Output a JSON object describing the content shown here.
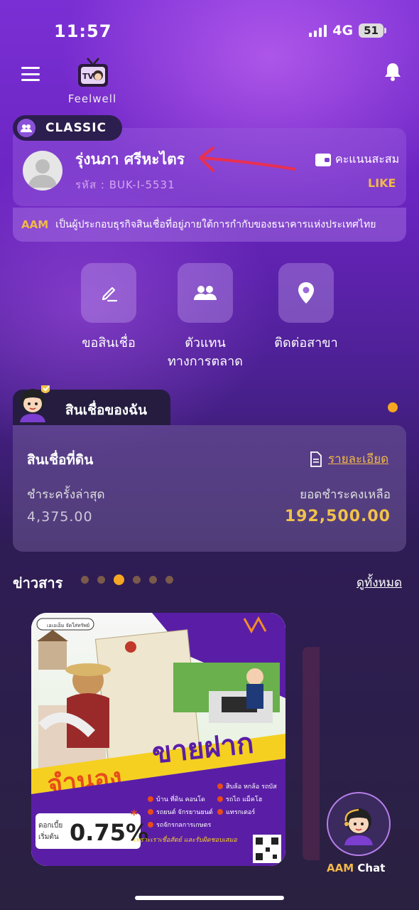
{
  "status_bar": {
    "time": "11:57",
    "network": "4G",
    "battery": "51"
  },
  "header": {
    "logo_text": "Feelwell",
    "logo_badge": "TV"
  },
  "profile": {
    "tier": "CLASSIC",
    "name": "รุ่งนภา ศรีหะไตร",
    "code": "รหัส : BUK-I-5531",
    "points_label": "คะแนนสะสม",
    "points_value": "LIKE"
  },
  "notice": {
    "brand": "AAM",
    "text": "เป็นผู้ประกอบธุรกิจสินเชื่อที่อยู่ภายใต้การกำกับของธนาคารแห่งประเทศไทย"
  },
  "actions": [
    {
      "label": "ขอสินเชื่อ",
      "icon": "pencil-icon"
    },
    {
      "label": "ตัวแทน\nทางการตลาด",
      "icon": "users-icon"
    },
    {
      "label": "ติดต่อสาขา",
      "icon": "location-pin-icon"
    }
  ],
  "my_loan": {
    "tab_label": "สินเชื่อของฉัน",
    "loan_type": "สินเชื่อที่ดิน",
    "detail_link": "รายละเอียด",
    "last_payment_label": "ชำระครั้งล่าสุด",
    "last_payment_value": "4,375.00",
    "balance_label": "ยอดชำระคงเหลือ",
    "balance_value": "192,500.00"
  },
  "news": {
    "title": "ข่าวสาร",
    "see_all": "ดูทั้งหมด",
    "dots": 6,
    "active_dot": 2,
    "banner": {
      "search_tag": "เอเอเอ็ม จัดใส่ทรัพย์",
      "headline_1": "จำนอง",
      "headline_2": "ขายฝาก",
      "rate_prefix": "ดอกเบี้ย",
      "rate_prefix2": "เริ่มต้น",
      "rate": "0.75%",
      "rate_star": "*",
      "items_left": [
        "บ้าน ที่ดิน คอนโด",
        "รถยนต์ จักรยานยนต์",
        "รถจักรกลการเกษตร"
      ],
      "items_right": [
        "สิบล้อ หกล้อ รถบัส",
        "รถไถ แม็คโฮ",
        "แทรกเตอร์"
      ],
      "slogan": "เพราะเราเชื่อสัตย์ และรับผิดชอบเสมอ"
    }
  },
  "chat": {
    "brand": "AAM",
    "label": "Chat"
  },
  "colors": {
    "accent": "#f2b84a",
    "orange_dot": "#f5a623",
    "banner_purple": "#5a1ea6"
  }
}
